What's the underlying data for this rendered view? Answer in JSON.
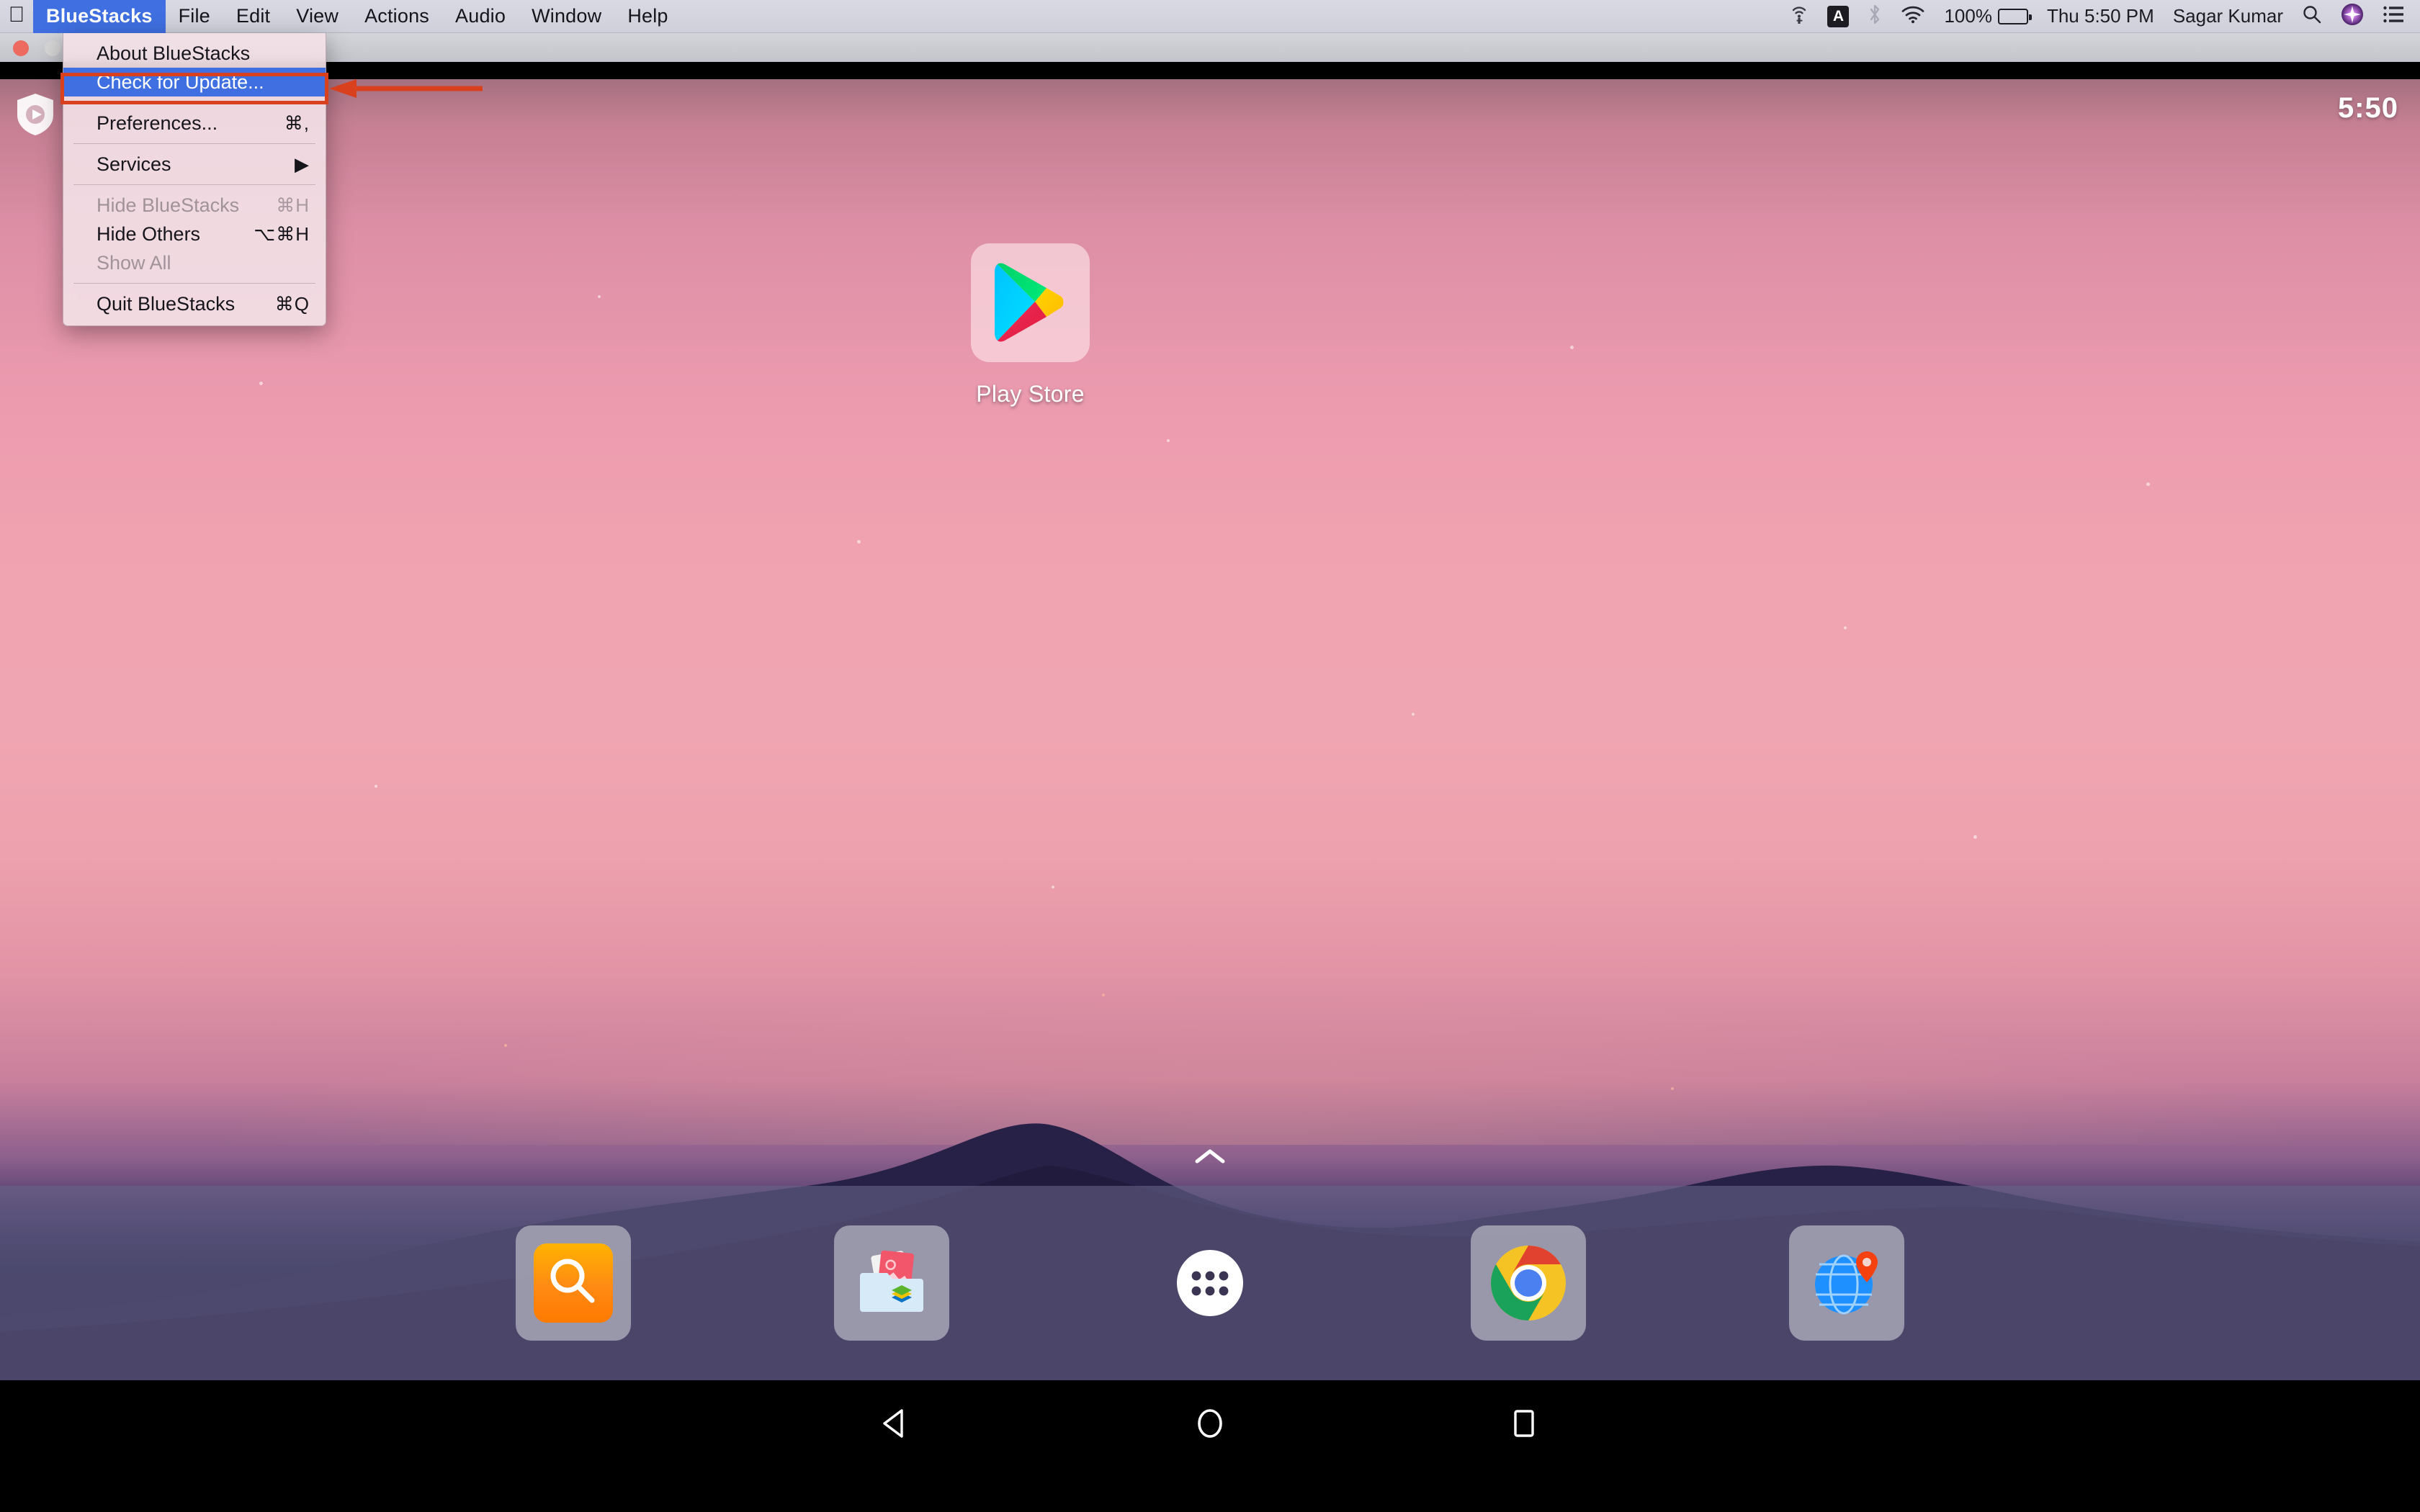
{
  "macos_menubar": {
    "apple_icon": "apple-logo-icon",
    "menus": [
      {
        "label": "BlueStacks",
        "active": true
      },
      {
        "label": "File",
        "active": false
      },
      {
        "label": "Edit",
        "active": false
      },
      {
        "label": "View",
        "active": false
      },
      {
        "label": "Actions",
        "active": false
      },
      {
        "label": "Audio",
        "active": false
      },
      {
        "label": "Window",
        "active": false
      },
      {
        "label": "Help",
        "active": false
      }
    ],
    "status_items": {
      "hotspot_icon": "personal-hotspot-icon",
      "input_source": "A",
      "bluetooth_icon": "bluetooth-icon",
      "wifi_icon": "wifi-icon",
      "battery_percent": "100%",
      "datetime": "Thu 5:50 PM",
      "user_name": "Sagar Kumar",
      "spotlight_icon": "search-icon",
      "siri_icon": "siri-icon",
      "notification_center_icon": "notification-center-icon"
    }
  },
  "window": {
    "close_button": "close-window-button",
    "minimize_button": "minimize-window-button"
  },
  "app_menu": {
    "title": "BlueStacks",
    "items": [
      {
        "label": "About BlueStacks",
        "shortcut": "",
        "state": "normal",
        "name": "menu-item-about-bluestacks"
      },
      {
        "label": "Check for Update...",
        "shortcut": "",
        "state": "selected",
        "name": "menu-item-check-for-update"
      },
      {
        "label": "Preferences...",
        "shortcut": "⌘,",
        "state": "normal",
        "name": "menu-item-preferences"
      },
      {
        "label": "Services",
        "shortcut": "▶",
        "state": "submenu",
        "name": "menu-item-services"
      },
      {
        "label": "Hide BlueStacks",
        "shortcut": "⌘H",
        "state": "disabled",
        "name": "menu-item-hide-bluestacks"
      },
      {
        "label": "Hide Others",
        "shortcut": "⌥⌘H",
        "state": "normal",
        "name": "menu-item-hide-others"
      },
      {
        "label": "Show All",
        "shortcut": "",
        "state": "disabled",
        "name": "menu-item-show-all"
      },
      {
        "label": "Quit BlueStacks",
        "shortcut": "⌘Q",
        "state": "normal",
        "name": "menu-item-quit-bluestacks"
      }
    ]
  },
  "annotation": {
    "highlight_color": "#d8401e",
    "points_to": "Check for Update..."
  },
  "android_home": {
    "status_clock": "5:50",
    "bluestacks_logo": "bluestacks-shield-icon",
    "app_shortcut": {
      "label": "Play Store",
      "icon": "google-play-store-icon"
    },
    "drawer_chevron": "chevron-up-icon",
    "dock": [
      {
        "name": "dock-item-search",
        "icon": "search-icon",
        "style": "tile"
      },
      {
        "name": "dock-item-media-manager",
        "icon": "media-manager-icon",
        "style": "tile"
      },
      {
        "name": "dock-item-app-drawer",
        "icon": "app-drawer-icon",
        "style": "bare"
      },
      {
        "name": "dock-item-chrome",
        "icon": "chrome-icon",
        "style": "tile"
      },
      {
        "name": "dock-item-browser",
        "icon": "globe-pin-icon",
        "style": "tile"
      }
    ],
    "navigation": [
      {
        "name": "nav-back-button",
        "icon": "back-triangle-icon"
      },
      {
        "name": "nav-home-button",
        "icon": "home-circle-icon"
      },
      {
        "name": "nav-recents-button",
        "icon": "recents-square-icon"
      }
    ]
  },
  "colors": {
    "menu_highlight": "#3f6fe0",
    "annotation": "#d8401e",
    "menubar_bg": "#d4d5de"
  }
}
